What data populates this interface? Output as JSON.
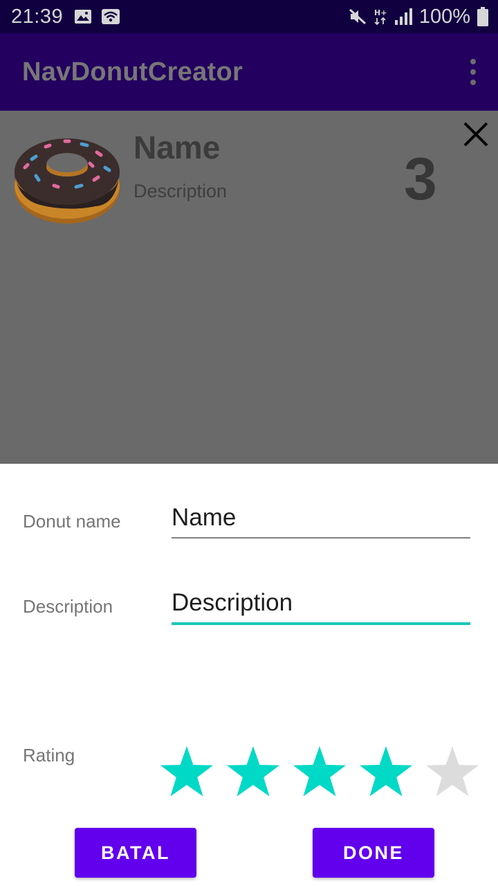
{
  "status_bar": {
    "time": "21:39",
    "battery_text": "100%",
    "left_icons": [
      "image-icon",
      "wifi-icon"
    ],
    "right_icons": [
      "mute-icon",
      "hplus-network-icon",
      "signal-icon",
      "battery-icon"
    ]
  },
  "app_bar": {
    "title": "NavDonutCreator",
    "menu_icon": "overflow-menu-icon"
  },
  "donut_item": {
    "name": "Name",
    "description": "Description",
    "rating": "3",
    "image_icon": "donut-icon",
    "delete_icon": "close-icon"
  },
  "editor": {
    "name_label": "Donut name",
    "name_value": "Name",
    "description_label": "Description",
    "description_value": "Description",
    "rating_label": "Rating",
    "rating_value": 4,
    "rating_max": 5,
    "star_filled_color": "#00d9c6",
    "star_empty_color": "#dcdcdc",
    "accent_color": "#19c7b8",
    "cancel_label": "BATAL",
    "done_label": "DONE"
  }
}
